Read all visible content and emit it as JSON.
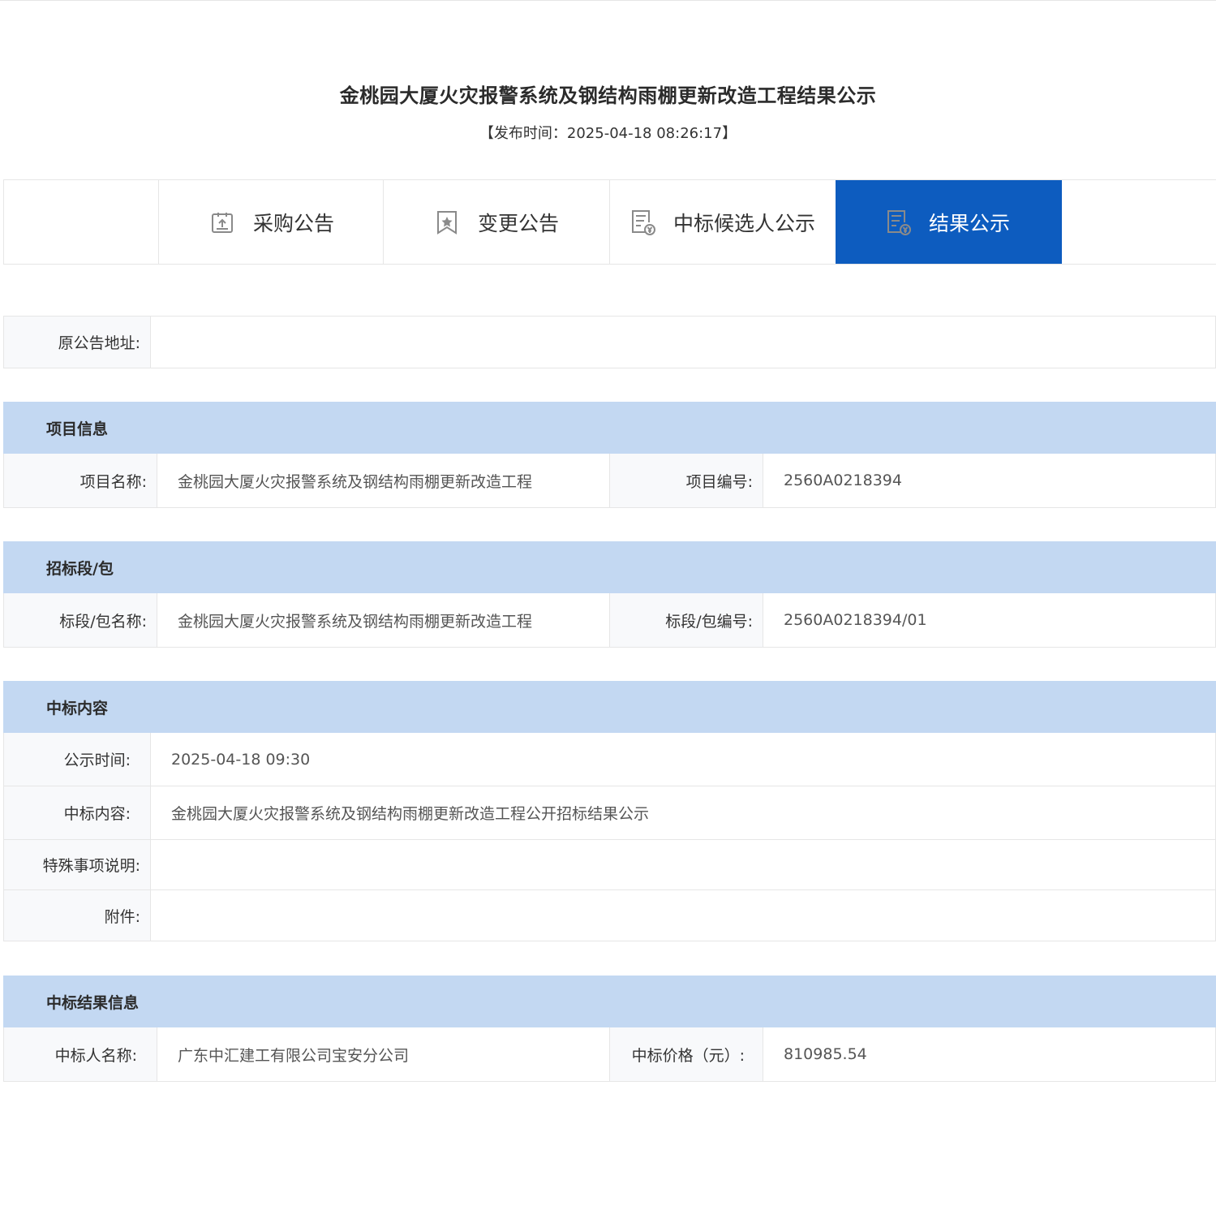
{
  "page": {
    "title": "金桃园大厦火灾报警系统及钢结构雨棚更新改造工程结果公示",
    "publish_time": "【发布时间：2025-04-18 08:26:17】"
  },
  "tabs": [
    {
      "label": "采购公告",
      "icon": "upload-document-icon",
      "active": false
    },
    {
      "label": "变更公告",
      "icon": "bookmark-star-icon",
      "active": false
    },
    {
      "label": "中标候选人公示",
      "icon": "document-yen-icon",
      "active": false
    },
    {
      "label": "结果公示",
      "icon": "document-yen-icon",
      "active": true
    }
  ],
  "original": {
    "label": "原公告地址:",
    "value": ""
  },
  "project": {
    "heading": "项目信息",
    "name_label": "项目名称:",
    "name_value": "金桃园大厦火灾报警系统及钢结构雨棚更新改造工程",
    "code_label": "项目编号:",
    "code_value": "2560A0218394"
  },
  "lot": {
    "heading": "招标段/包",
    "name_label": "标段/包名称:",
    "name_value": "金桃园大厦火灾报警系统及钢结构雨棚更新改造工程",
    "code_label": "标段/包编号:",
    "code_value": "2560A0218394/01"
  },
  "award": {
    "heading": "中标内容",
    "time_label": "公示时间:",
    "time_value": "2025-04-18 09:30",
    "content_label": "中标内容:",
    "content_value": "金桃园大厦火灾报警系统及钢结构雨棚更新改造工程公开招标结果公示",
    "special_label": "特殊事项说明:",
    "special_value": "",
    "attach_label": "附件:",
    "attach_value": ""
  },
  "result": {
    "heading": "中标结果信息",
    "winner_label": "中标人名称:",
    "winner_value": "广东中汇建工有限公司宝安分公司",
    "price_label": "中标价格（元）:",
    "price_value": "810985.54"
  },
  "colors": {
    "accent": "#0d5cbf",
    "section_header": "#c3d8f2",
    "label_bg": "#f8f9fb",
    "border": "#e6e6e6"
  }
}
